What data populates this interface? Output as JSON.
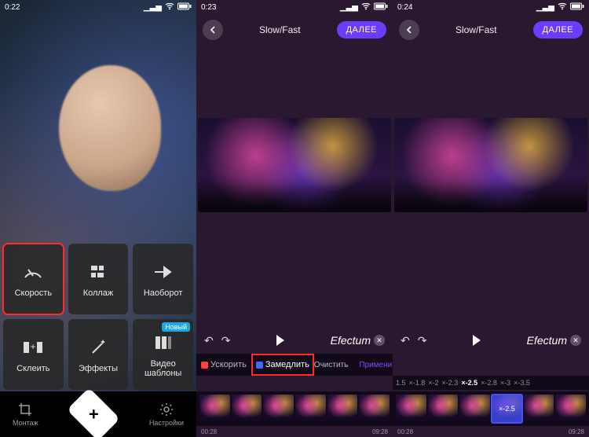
{
  "panelA": {
    "status_time": "0:22",
    "tiles": [
      {
        "name": "speed",
        "label": "Скорость",
        "highlight": true
      },
      {
        "name": "collage",
        "label": "Коллаж"
      },
      {
        "name": "reverse",
        "label": "Наоборот"
      },
      {
        "name": "splice",
        "label": "Склеить"
      },
      {
        "name": "effects",
        "label": "Эффекты"
      },
      {
        "name": "templates",
        "label": "Видео шаблоны",
        "badge": "Новый"
      }
    ],
    "bottom": {
      "montage": "Монтаж",
      "settings": "Настройки"
    }
  },
  "panelB": {
    "status_time": "0:23",
    "title": "Slow/Fast",
    "next": "ДАЛЕЕ",
    "brand": "Efectum",
    "tabs": {
      "speedup": "Ускорить",
      "slowdown": "Замедлить",
      "clear": "Очистить",
      "apply": "Применить"
    },
    "time_start": "00:28",
    "time_end": "09:28"
  },
  "panelC": {
    "status_time": "0:24",
    "title": "Slow/Fast",
    "next": "ДАЛЕЕ",
    "brand": "Efectum",
    "multipliers": [
      "1.5",
      "×-1.8",
      "×-2",
      "×-2.3",
      "×-2.5",
      "×-2.8",
      "×-3",
      "×-3.5"
    ],
    "active_mul": "×-2.5",
    "sel_label": "×-2.5",
    "time_start": "00:28",
    "time_end": "09:28"
  }
}
